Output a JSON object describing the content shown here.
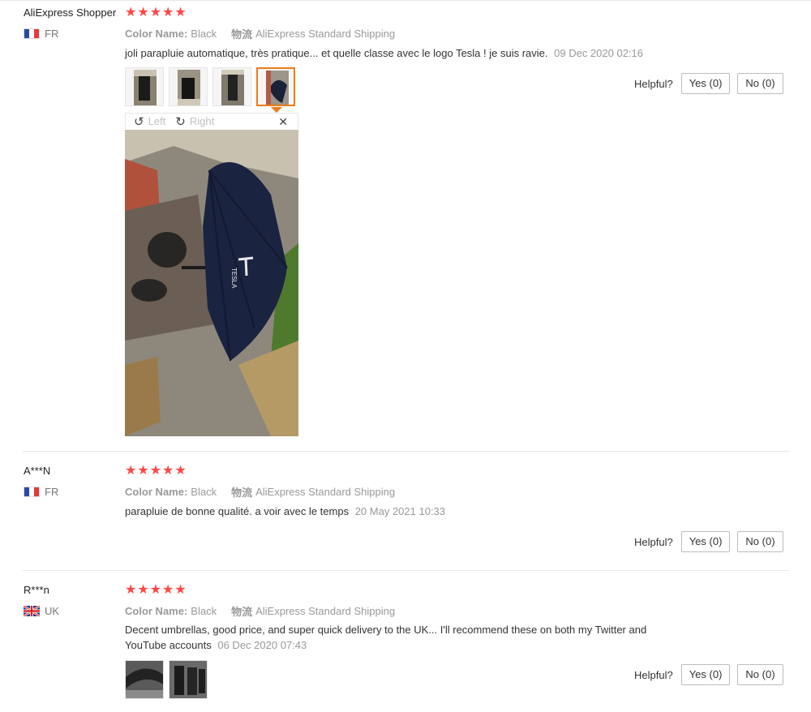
{
  "reviews": [
    {
      "user": "AliExpress Shopper",
      "country": "FR",
      "flag_icon": "france-flag-icon",
      "stars": "★★★★★",
      "rating": 5,
      "color_key": "Color Name:",
      "color_value": "Black",
      "shipping_key": "物流",
      "shipping_value": "AliExpress Standard Shipping",
      "text": "joli parapluie automatique, très pratique... et quelle classe avec le logo Tesla ! je suis ravie.",
      "date": "09 Dec 2020 02:16",
      "helpful_label": "Helpful?",
      "yes_label": "Yes (0)",
      "no_label": "No (0)",
      "viewer": {
        "left_label": "Left",
        "right_label": "Right",
        "close_icon": "close-icon",
        "rotate_left_icon": "rotate-left-icon",
        "rotate_right_icon": "rotate-right-icon"
      },
      "photo_logo_text": "TESLA"
    },
    {
      "user": "A***N",
      "country": "FR",
      "flag_icon": "france-flag-icon",
      "stars": "★★★★★",
      "rating": 5,
      "color_key": "Color Name:",
      "color_value": "Black",
      "shipping_key": "物流",
      "shipping_value": "AliExpress Standard Shipping",
      "text": "parapluie de bonne qualité. a voir avec le temps",
      "date": "20 May 2021 10:33",
      "helpful_label": "Helpful?",
      "yes_label": "Yes (0)",
      "no_label": "No (0)"
    },
    {
      "user": "R***n",
      "country": "UK",
      "flag_icon": "uk-flag-icon",
      "stars": "★★★★★",
      "rating": 5,
      "color_key": "Color Name:",
      "color_value": "Black",
      "shipping_key": "物流",
      "shipping_value": "AliExpress Standard Shipping",
      "text_line1": "Decent umbrellas, good price, and super quick delivery to the UK... I'll recommend these on both my Twitter and",
      "text_line2": "YouTube accounts",
      "date": "06 Dec 2020 07:43",
      "helpful_label": "Helpful?",
      "yes_label": "Yes (0)",
      "no_label": "No (0)"
    }
  ],
  "colors": {
    "star": "#ff4747",
    "active_thumb": "#e87d1a",
    "muted": "#999999"
  }
}
